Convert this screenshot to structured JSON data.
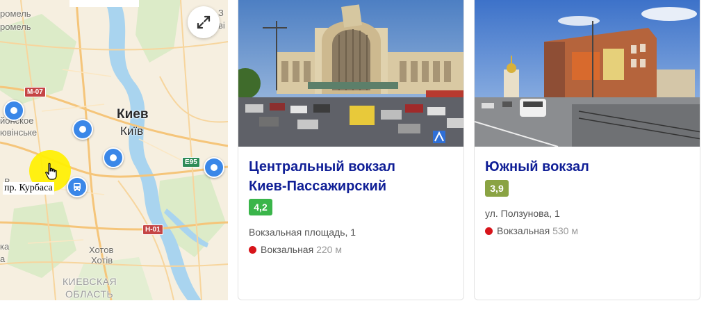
{
  "map": {
    "labels": {
      "romel_1": "ромель",
      "romel_2": "ромель",
      "sofiyivska_ru": "йонское",
      "sofiyivska_ua": "ювінське",
      "kyiv_ru": "Киев",
      "kyiv_ua": "Київ",
      "khotov_ru": "Хотов",
      "khotov_ua": "Хотів",
      "region_line1": "КИЕВСКАЯ",
      "region_line2": "ОБЛАСТЬ",
      "edge_v": "В",
      "edge_ka": "ка",
      "edge_a": "а",
      "edge_z": "З",
      "edge_v2": "ві"
    },
    "shields": {
      "m07": "M-07",
      "e95": "E95",
      "h01": "H-01"
    },
    "street_tag": "пр. Курбаса",
    "expand_icon": "expand-icon",
    "cursor_icon": "hand-pointer-icon"
  },
  "cards": [
    {
      "title_line1": "Центральный вокзал",
      "title_line2": "Киев-Пассажирский",
      "rating": "4,2",
      "address": "Вокзальная площадь, 1",
      "metro_station": "Вокзальная",
      "metro_distance": "220 м",
      "metro_color": "#d7141a",
      "rating_color": "#3ab54a"
    },
    {
      "title_line1": "Южный вокзал",
      "rating": "3,9",
      "address": "ул. Ползунова, 1",
      "metro_station": "Вокзальная",
      "metro_distance": "530 м",
      "metro_color": "#d7141a",
      "rating_color": "#8aa343"
    }
  ],
  "colors": {
    "title": "#0f1e96",
    "map_background": "#f6efe0",
    "river": "#a9d4ef",
    "poi": "#3a87e8"
  }
}
